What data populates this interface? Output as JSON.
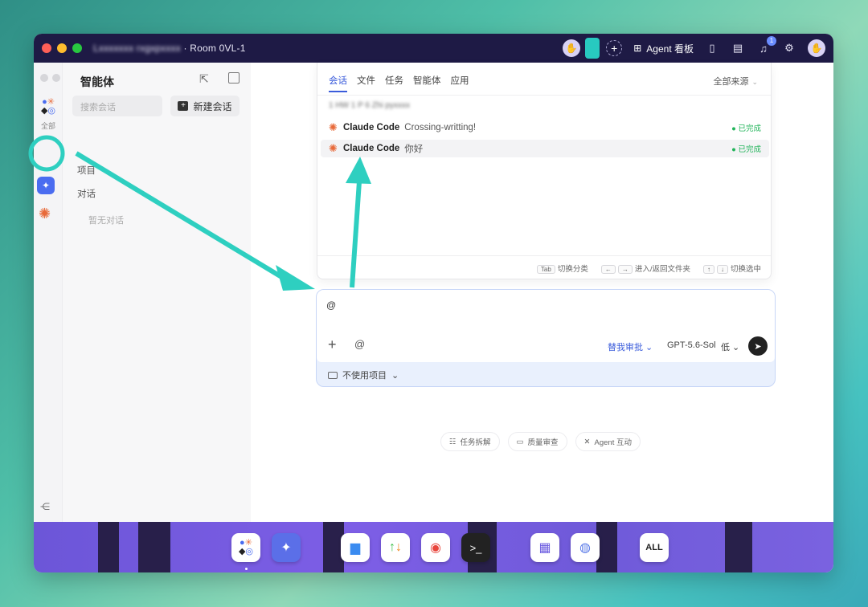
{
  "window": {
    "title_blurred": "Lxxxxxxx rxgxpxxxx",
    "title_room": "· Room 0VL-1"
  },
  "titlebar": {
    "agent_board_label": "Agent 看板",
    "notification_count": "1"
  },
  "rail": {
    "all_label": "全部"
  },
  "sidebar": {
    "title": "智能体",
    "search_placeholder": "搜索会话",
    "new_chat_label": "新建会话",
    "section_projects": "项目",
    "section_chats": "对话",
    "empty_text": "暂无对话"
  },
  "popup": {
    "tabs": [
      {
        "label": "会话",
        "active": true
      },
      {
        "label": "文件",
        "active": false
      },
      {
        "label": "任务",
        "active": false
      },
      {
        "label": "智能体",
        "active": false
      },
      {
        "label": "应用",
        "active": false
      }
    ],
    "source_filter": "全部来源",
    "blurred_heading": "1 HW 1 P 6 Zhi pyxxxx",
    "rows": [
      {
        "agent": "Claude Code",
        "message": "Crossing-writting!",
        "status": "● 已完成",
        "selected": false
      },
      {
        "agent": "Claude Code",
        "message": "你好",
        "status": "● 已完成",
        "selected": true
      }
    ],
    "hints": [
      {
        "keys": [
          "Tab"
        ],
        "label": "切换分类"
      },
      {
        "keys": [
          "←",
          "→"
        ],
        "label": "进入/返回文件夹"
      },
      {
        "keys": [
          "↑",
          "↓"
        ],
        "label": "切换选中"
      }
    ]
  },
  "composer": {
    "text": "@",
    "approve_label": "替我审批",
    "model": "GPT-5.6-Sol",
    "level": "低",
    "project_label": "不使用项目"
  },
  "chips": [
    {
      "label": "任务拆解"
    },
    {
      "label": "质量审查"
    },
    {
      "label": "Agent 互动"
    }
  ],
  "dock": {
    "all_label": "ALL"
  },
  "colors": {
    "accent": "#3b5cdb",
    "annotation": "#2ecfc0",
    "status_done": "#22b45a"
  }
}
